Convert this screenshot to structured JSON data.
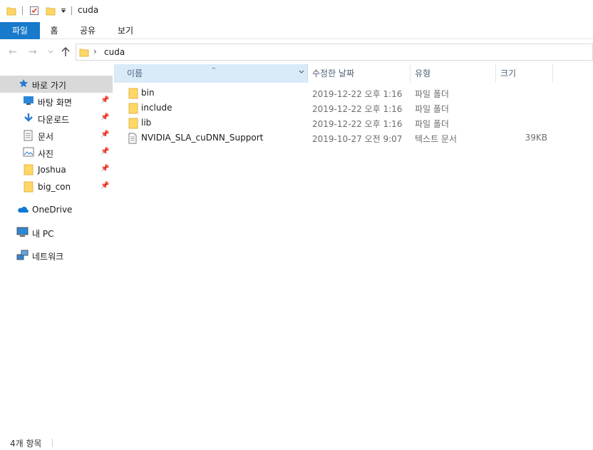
{
  "window": {
    "title": "cuda"
  },
  "ribbon": {
    "tabs": [
      {
        "label": "파일"
      },
      {
        "label": "홈"
      },
      {
        "label": "공유"
      },
      {
        "label": "보기"
      }
    ]
  },
  "address": {
    "path": [
      "cuda"
    ]
  },
  "navpane": {
    "quick_access": {
      "label": "바로 가기"
    },
    "pinned": [
      {
        "label": "바탕 화면",
        "icon": "desktop-icon"
      },
      {
        "label": "다운로드",
        "icon": "download-icon"
      },
      {
        "label": "문서",
        "icon": "documents-icon"
      },
      {
        "label": "사진",
        "icon": "pictures-icon"
      },
      {
        "label": "Joshua",
        "icon": "folder-icon"
      },
      {
        "label": "big_con",
        "icon": "folder-icon"
      }
    ],
    "onedrive": {
      "label": "OneDrive"
    },
    "this_pc": {
      "label": "내 PC"
    },
    "network": {
      "label": "네트워크"
    }
  },
  "columns": {
    "name": "이름",
    "date": "수정한 날짜",
    "type": "유형",
    "size": "크기"
  },
  "files": [
    {
      "name": "bin",
      "date": "2019-12-22 오후 1:16",
      "type": "파일 폴더",
      "size": "",
      "icon": "folder-icon"
    },
    {
      "name": "include",
      "date": "2019-12-22 오후 1:16",
      "type": "파일 폴더",
      "size": "",
      "icon": "folder-icon"
    },
    {
      "name": "lib",
      "date": "2019-12-22 오후 1:16",
      "type": "파일 폴더",
      "size": "",
      "icon": "folder-icon"
    },
    {
      "name": "NVIDIA_SLA_cuDNN_Support",
      "date": "2019-10-27 오전 9:07",
      "type": "텍스트 문서",
      "size": "39KB",
      "icon": "text-file-icon"
    }
  ],
  "status": {
    "item_count": "4개 항목"
  },
  "colors": {
    "file_tab": "#1979ca",
    "selected_header": "#d9ebf9",
    "folder": "#ffd766"
  }
}
